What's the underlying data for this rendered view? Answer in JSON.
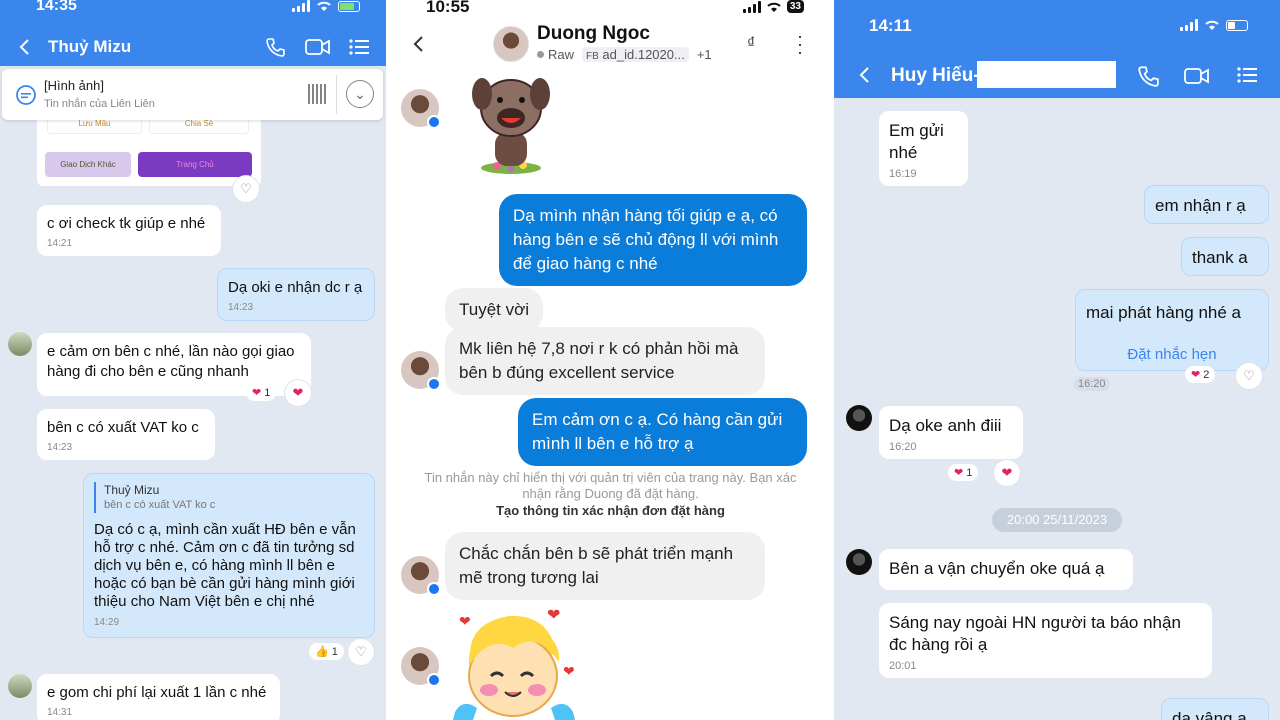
{
  "panel1": {
    "status_time": "14:35",
    "header_name": "Thuỷ Mizu",
    "pinned": {
      "title": "[Hình ảnh]",
      "subtitle": "Tin nhắn của Liên Liên"
    },
    "card_buttons": [
      "Lưu Mẫu",
      "Chia Sẻ",
      "Giao Dịch Khác",
      "Trang Chủ"
    ],
    "messages": [
      {
        "text": "c ơi check tk giúp e nhé",
        "time": "14:21"
      },
      {
        "text": "Dạ oki e nhận dc r ạ",
        "time": "14:23"
      },
      {
        "text": "e cảm ơn bên c nhé, lần nào gọi giao hàng đi cho bên e cũng nhanh",
        "reaction_count": "1"
      },
      {
        "text": "bên c có xuất VAT ko c",
        "time": "14:23"
      },
      {
        "quote_name": "Thuỷ Mizu",
        "quote_text": "bên c có xuất VAT ko c",
        "text": "Dạ có c ạ, mình cần xuất HĐ bên e vẫn hỗ trợ c nhé.  Cảm ơn c đã tin tưởng sd dịch vụ bên e, có hàng mình ll bên e hoặc có bạn bè cần gửi hàng mình giới thiệu cho Nam Việt bên e chị nhé",
        "time": "14:29",
        "reaction_count": "1"
      },
      {
        "text": "e gom chi phí lại xuất 1 lần c nhé",
        "time": "14:31"
      }
    ]
  },
  "panel2": {
    "status_time": "10:55",
    "battery": "33",
    "header_name": "Duong Ngoc",
    "sub_raw": "Raw",
    "sub_fb": "FB",
    "sub_ad": "ad_id.12020...",
    "sub_more": "+1",
    "messages": [
      {
        "text": "Dạ mình nhận hàng tối giúp e ạ, có hàng bên e sẽ chủ động ll với mình để giao hàng c nhé"
      },
      {
        "text": "Tuyệt vời"
      },
      {
        "text": "Mk liên hệ 7,8 nơi r k có phản hồi mà bên b đúng excellent service"
      },
      {
        "text": "Em cảm ơn c ạ. Có hàng cần gửi mình ll bên e hỗ trợ ạ"
      },
      {
        "text": "Chắc chắn bên b sẽ phát triển mạnh mẽ trong tương lai"
      }
    ],
    "notice": "Tin nhắn này chỉ hiển thị với quản trị viên của trang này. Bạn xác nhận rằng Duong đã đặt hàng.",
    "notice_link": "Tạo thông tin xác nhận đơn đặt hàng"
  },
  "panel3": {
    "status_time": "14:11",
    "header_name": "Huy Hiếu-",
    "messages": [
      {
        "text": "Em gửi nhé",
        "time": "16:19"
      },
      {
        "text": "em nhận r ạ"
      },
      {
        "text": "thank a"
      },
      {
        "text": "mai phát hàng nhé a",
        "link": "Đặt nhắc hẹn",
        "time": "16:20",
        "reaction_count": "2"
      },
      {
        "text": "Dạ oke anh điii",
        "time": "16:20",
        "reaction_count": "1"
      },
      {
        "text": "Bên a vận chuyển oke quá ạ"
      },
      {
        "text": "Sáng nay ngoài HN người ta báo nhận đc hàng rồi ạ",
        "time": "20:01"
      },
      {
        "text": "dạ vâng ạ"
      }
    ],
    "date_divider": "20:00 25/11/2023"
  }
}
